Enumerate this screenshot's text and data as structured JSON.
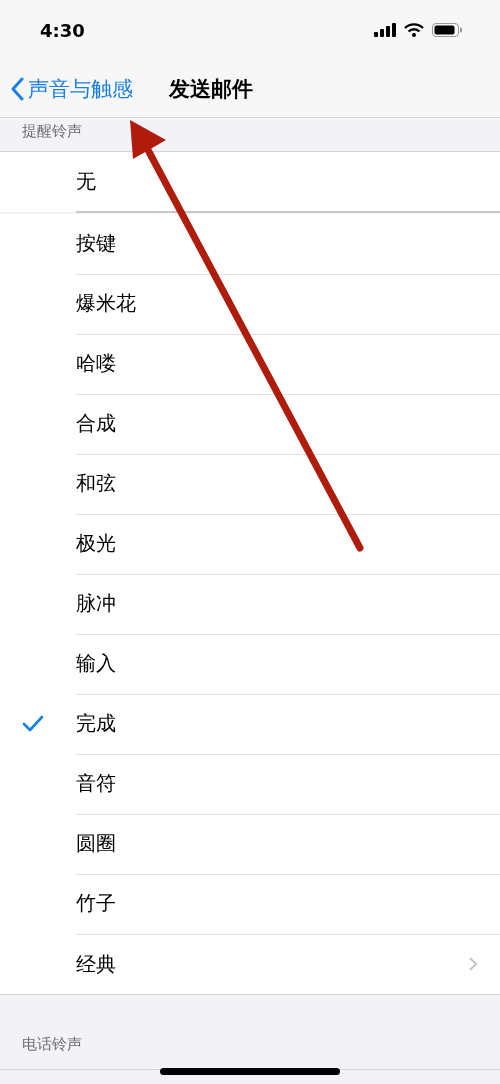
{
  "status_bar": {
    "time": "4:30"
  },
  "nav": {
    "back": "声音与触感",
    "title": "发送邮件"
  },
  "section_header": "提醒铃声",
  "none_row": {
    "label": "无",
    "selected": false
  },
  "tones": [
    {
      "label": "按键",
      "kind": "tone",
      "selected": false
    },
    {
      "label": "爆米花",
      "kind": "tone",
      "selected": false
    },
    {
      "label": "哈喽",
      "kind": "tone",
      "selected": false
    },
    {
      "label": "合成",
      "kind": "tone",
      "selected": false
    },
    {
      "label": "和弦",
      "kind": "tone",
      "selected": false
    },
    {
      "label": "极光",
      "kind": "tone",
      "selected": false
    },
    {
      "label": "脉冲",
      "kind": "tone",
      "selected": false
    },
    {
      "label": "输入",
      "kind": "tone",
      "selected": false
    },
    {
      "label": "完成",
      "kind": "tone",
      "selected": true
    },
    {
      "label": "音符",
      "kind": "tone",
      "selected": false
    },
    {
      "label": "圆圈",
      "kind": "tone",
      "selected": false
    },
    {
      "label": "竹子",
      "kind": "tone",
      "selected": false
    },
    {
      "label": "经典",
      "kind": "link",
      "selected": false
    }
  ],
  "next_section_header": "电话铃声"
}
